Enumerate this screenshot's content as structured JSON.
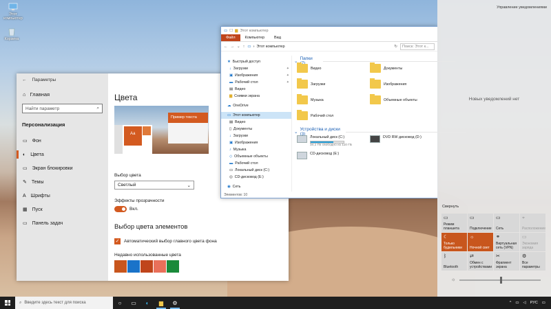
{
  "desktop": {
    "icons": [
      {
        "label": "Этот компьютер"
      },
      {
        "label": "Корзина"
      }
    ]
  },
  "settings": {
    "title": "Параметры",
    "home": "Главная",
    "search_placeholder": "Найти параметр",
    "section": "Персонализация",
    "nav": [
      {
        "label": "Фон",
        "icon": "image-icon"
      },
      {
        "label": "Цвета",
        "icon": "palette-icon"
      },
      {
        "label": "Экран блокировки",
        "icon": "monitor-icon"
      },
      {
        "label": "Темы",
        "icon": "brush-icon"
      },
      {
        "label": "Шрифты",
        "icon": "font-icon"
      },
      {
        "label": "Пуск",
        "icon": "start-icon"
      },
      {
        "label": "Панель задач",
        "icon": "taskbar-icon"
      }
    ],
    "page_title": "Цвета",
    "preview_tile_text": "Аа",
    "preview_sample_text": "Пример текста",
    "color_choice_label": "Выбор цвета",
    "color_choice_value": "Светлый",
    "transparency_label": "Эффекты прозрачности",
    "transparency_value": "Вкл.",
    "accent_heading": "Выбор цвета элементов",
    "auto_accent_label": "Автоматический выбор главного цвета фона",
    "recent_colors_label": "Недавно использованные цвета",
    "recent_colors": [
      "#c8561d",
      "#1a73c9",
      "#c0451b",
      "#e9705a",
      "#1a8a3a"
    ],
    "accent_color": "#d35a20"
  },
  "explorer": {
    "title": "Этот компьютер",
    "tabs": [
      "Файл",
      "Компьютер",
      "Вид"
    ],
    "address": "Этот компьютер",
    "search_placeholder": "Поиск: Этот к...",
    "nav": {
      "quick_access": "Быстрый доступ",
      "quick_items": [
        "Загрузки",
        "Изображения",
        "Рабочий стол",
        "Видео",
        "Снимки экрана"
      ],
      "onedrive": "OneDrive",
      "this_pc": "Этот компьютер",
      "pc_items": [
        "Видео",
        "Документы",
        "Загрузки",
        "Изображения",
        "Музыка",
        "Объемные объекты",
        "Рабочий стол",
        "Локальный диск (C:)",
        "CD-дисковод (E:)"
      ],
      "network": "Сеть"
    },
    "folders_heading": "Папки (7)",
    "folders": [
      "Видео",
      "Документы",
      "Загрузки",
      "Изображения",
      "Музыка",
      "Объемные объекты",
      "Рабочий стол"
    ],
    "devices_heading": "Устройства и диски (3)",
    "drives": {
      "c_name": "Локальный диск (C:)",
      "c_space": "34,1 ГБ свободно из 110 ГБ",
      "c_used_fraction": 0.69,
      "dvd_name": "DVD RW дисковод (D:)",
      "cd_name": "CD-дисковод (E:)"
    },
    "status": "Элементов: 10"
  },
  "action_center": {
    "manage": "Управление уведомлениями",
    "empty": "Новых уведомлений нет",
    "collapse": "Свернуть",
    "tiles": [
      {
        "label": "Режим планшета",
        "icon": "tablet-icon",
        "state": "off"
      },
      {
        "label": "Подключение",
        "icon": "connect-icon",
        "state": "off"
      },
      {
        "label": "Сеть",
        "icon": "network-icon",
        "state": "off"
      },
      {
        "label": "Расположение",
        "icon": "location-icon",
        "state": "dim"
      },
      {
        "label": "Только будильники",
        "icon": "moon-icon",
        "state": "on"
      },
      {
        "label": "Ночной свет",
        "icon": "sun-icon",
        "state": "on"
      },
      {
        "label": "Виртуальная сеть (VPN)",
        "icon": "vpn-icon",
        "state": "off"
      },
      {
        "label": "Экономия заряда",
        "icon": "battery-icon",
        "state": "dim"
      },
      {
        "label": "Bluetooth",
        "icon": "bluetooth-icon",
        "state": "off"
      },
      {
        "label": "Обмен с устройствами",
        "icon": "share-icon",
        "state": "off"
      },
      {
        "label": "Фрагмент экрана",
        "icon": "snip-icon",
        "state": "off"
      },
      {
        "label": "Все параметры",
        "icon": "gear-icon",
        "state": "off"
      }
    ]
  },
  "taskbar": {
    "search_placeholder": "Введите здесь текст для поиска",
    "language": "РУС"
  }
}
